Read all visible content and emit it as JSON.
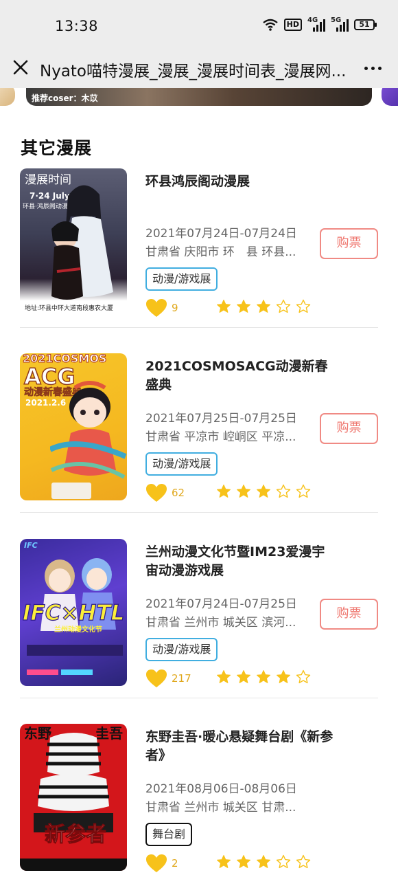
{
  "status_bar": {
    "time": "13:38",
    "hd_label": "HD",
    "net1": "4G",
    "net2": "5G",
    "battery": "51"
  },
  "nav": {
    "title": "Nyato喵特漫展_漫展_漫展时间表_漫展网..."
  },
  "banner": {
    "caption": "推荐coser：木苡"
  },
  "section": {
    "title": "其它漫展"
  },
  "events": [
    {
      "title": "环县鸿辰阁动漫展",
      "date": "2021年07月24日-07月24日",
      "address": "甘肃省 庆阳市 环　县 环县...",
      "tag": "动漫/游戏展",
      "buy_label": "购票",
      "likes": "9",
      "rating": 3,
      "poster": {
        "line1": "漫展时间",
        "line2": "7·24 July",
        "line3": "环县·鸿辰阁动漫展",
        "footer": "地址:环县中环大道南段惠农大厦"
      }
    },
    {
      "title": "2021COSMOSACG动漫新春盛典",
      "date": "2021年07月25日-07月25日",
      "address": "甘肃省 平凉市 崆峒区 平凉...",
      "tag": "动漫/游戏展",
      "buy_label": "购票",
      "likes": "62",
      "rating": 3,
      "poster": {
        "line1": "2021COSMOS",
        "line2": "ACG",
        "line3": "动漫新春盛典",
        "footer": "2021.2.6"
      }
    },
    {
      "title": "兰州动漫文化节暨IM23爱漫宇宙动漫游戏展",
      "date": "2021年07月24日-07月25日",
      "address": "甘肃省 兰州市 城关区 滨河...",
      "tag": "动漫/游戏展",
      "buy_label": "购票",
      "likes": "217",
      "rating": 4,
      "poster": {
        "line1": "IFC",
        "line2": "IFC×HTL",
        "line3": "兰州动漫文化节",
        "footer": ""
      }
    },
    {
      "title": "东野圭吾·暖心悬疑舞台剧《新参者》",
      "date": "2021年08月06日-08月06日",
      "address": "甘肃省 兰州市 城关区 甘肃...",
      "tag": "舞台剧",
      "likes": "2",
      "rating": 3,
      "poster": {
        "line1": "东野",
        "line2": "圭吾",
        "line3": "新参者",
        "footer": ""
      }
    }
  ],
  "colors": {
    "tag_border": "#41aee0",
    "buy_border": "#f08a84",
    "star": "#f7c21a",
    "heart": "#f7c21a"
  }
}
